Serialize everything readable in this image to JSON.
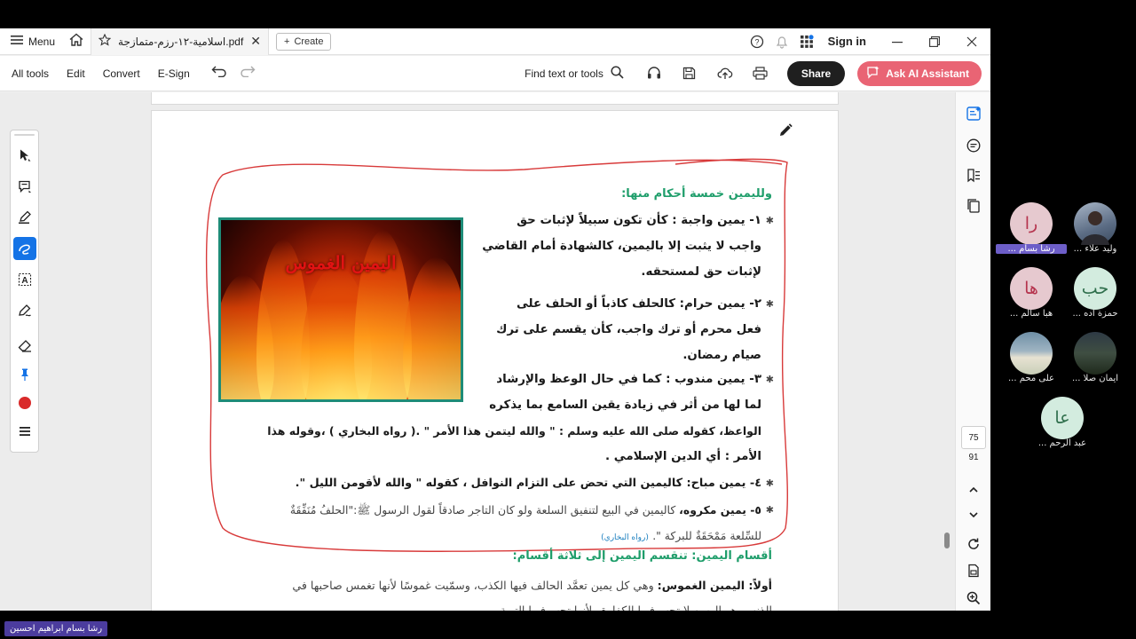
{
  "tabbar": {
    "menu_label": "Menu",
    "tab_title": "اسلامية-١٢-رزم-متمازجة.pdf",
    "create_label": "Create",
    "signin_label": "Sign in"
  },
  "toolbar": {
    "items": [
      "All tools",
      "Edit",
      "Convert",
      "E-Sign"
    ],
    "find_label": "Find text or tools",
    "share_label": "Share",
    "ai_label": "Ask AI Assistant"
  },
  "document": {
    "heading": "ولليمين خمسة أحكام منها:",
    "image_title": "اليمين الغموس",
    "item1": [
      "١- يمين واجبة : كأن تكون سبيلاً لإثبات حق",
      "واجب لا يثبت إلا باليمين، كالشهادة أمام القاضي",
      "لإثبات حق لمستحقه."
    ],
    "item2": [
      "٢- يمين حرام: كالحلف كاذباً أو الحلف على",
      "فعل محرم أو ترك واجب، كأن يقسم على ترك",
      "صيام رمضان."
    ],
    "item3": [
      "٣- يمين مندوب : كما في حال الوعظ والإرشاد",
      "لما لها من أثر في زيادة يقين السامع  بما يذكره",
      "الواعظ، كقوله صلى الله عليه وسلم : \" والله ليتمن هذا الأمر \" .( رواه البخاري ) ،وقوله هذا",
      "الأمر : أي الدين الإسلامي ."
    ],
    "item4": "٤- يمين مباح: كاليمين التي تحض على التزام النوافل ، كقوله \" والله لأقومن الليل \".",
    "item5_bold": "٥- يمين مكروه،",
    "item5_rest": " كاليمين في البيع لتنفيق السلعة ولو كان التاجر صادقاً لقول الرسول ﷺ:\"الحلفُ مُنَفِّقَةٌ",
    "item5_line2": "للسِّلعة مَمْحَقَةٌ للبركة \".",
    "item5_ref": "(رواه البخاري)",
    "section_heading": "أقسام اليمين: تنقسم اليمين إلى ثلاثة أقسام:",
    "first_bold": "أولاً: اليمين الغموس:",
    "first_rest": " وهي كل يمين تعمَّد الحالف فيها الكذب، وسمّيت غموسًا لأنها تغمس صاحبها في",
    "first_line2": "الذنب وهو اليمين لا تجب فيها الكفارة ولأنها تجب فيها التوبة."
  },
  "sidebar": {
    "page_current": "75",
    "page_total": "91"
  },
  "participants": [
    {
      "initials": "را",
      "name": "رشا بسام ...",
      "color": "#e6c9cf",
      "text_color": "#b5334d",
      "highlight": true
    },
    {
      "initials": "",
      "name": "وليد علاء ...",
      "color": "#7a8aa0",
      "text_color": "#fff",
      "highlight": false
    },
    {
      "initials": "ها",
      "name": "هبا سالم ...",
      "color": "#e6c9cf",
      "text_color": "#b5334d",
      "highlight": false
    },
    {
      "initials": "حب",
      "name": "حمزة اده ...",
      "color": "#d3ecdf",
      "text_color": "#2f6f4c",
      "highlight": false
    },
    {
      "initials": "",
      "name": "على محم ...",
      "color": "#a8b8c2",
      "text_color": "#fff",
      "highlight": false
    },
    {
      "initials": "",
      "name": "ايمان صلا ...",
      "color": "#3c4a3a",
      "text_color": "#fff",
      "highlight": false
    },
    {
      "initials": "عا",
      "name": "عبد الرحم ...",
      "color": "#d3ecdf",
      "text_color": "#2f6f4c",
      "highlight": false
    }
  ],
  "bottom_label": "رشا بسام ابراهيم احسين"
}
